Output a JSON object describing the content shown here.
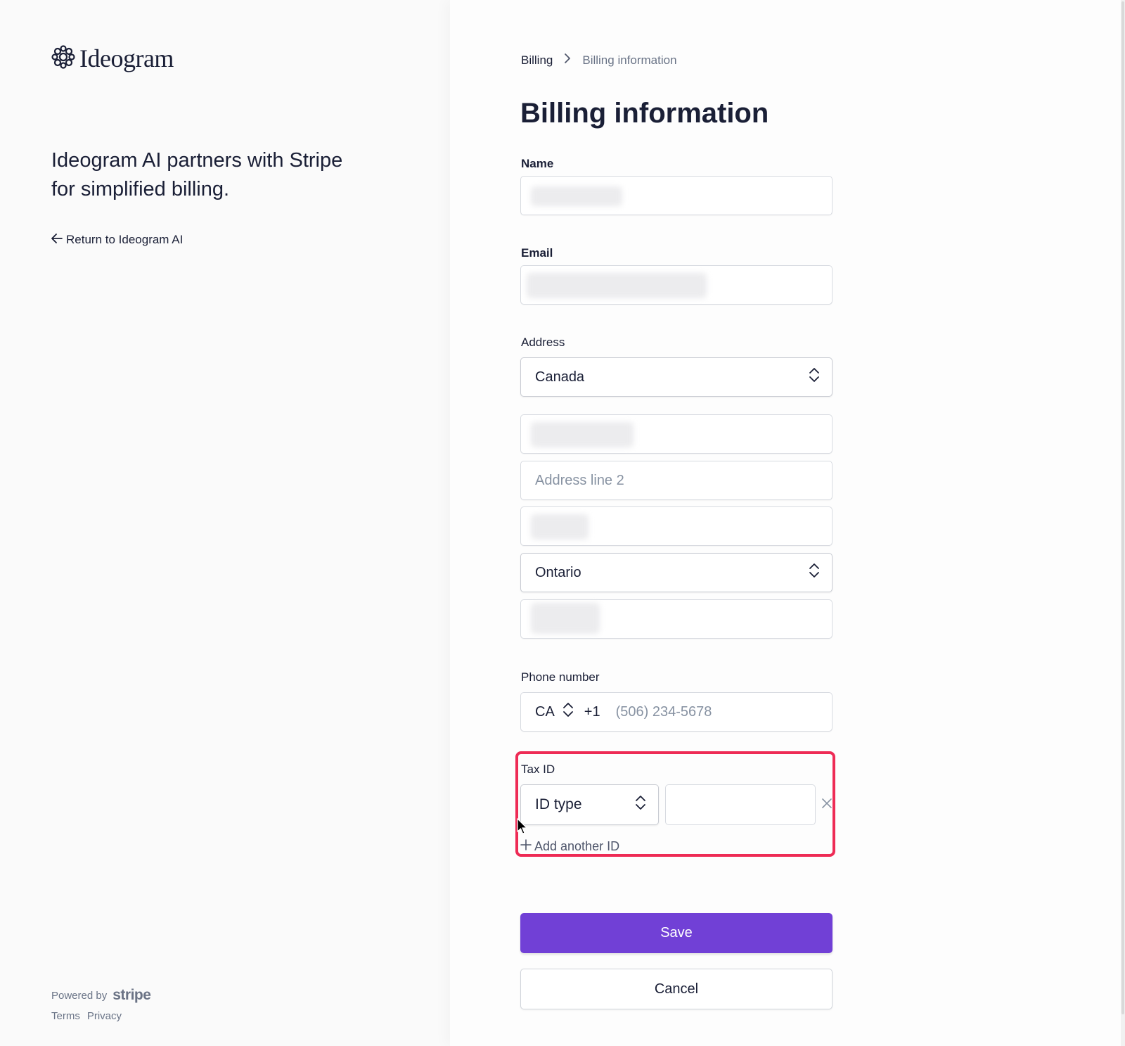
{
  "brand": {
    "logo_text": "Ideogram",
    "tagline": "Ideogram AI partners with Stripe for simplified billing.",
    "return_link": "Return to Ideogram AI",
    "powered_by": "Powered by",
    "stripe_word": "stripe",
    "footer_links": [
      "Terms",
      "Privacy"
    ]
  },
  "breadcrumb": {
    "parent": "Billing",
    "current": "Billing information"
  },
  "page_title": "Billing information",
  "form": {
    "name_label": "Name",
    "email_label": "Email",
    "address_label": "Address",
    "country_value": "Canada",
    "address_line2_placeholder": "Address line 2",
    "province_value": "Ontario",
    "phone_label": "Phone number",
    "phone_country": "CA",
    "phone_prefix": "+1",
    "phone_placeholder": "(506) 234-5678",
    "tax_id_label": "Tax ID",
    "id_type_placeholder": "ID type",
    "add_another_id": "Add another ID",
    "save_label": "Save",
    "cancel_label": "Cancel"
  },
  "icons": {
    "logo_mark": "brain-icon",
    "return": "arrow-left-icon",
    "breadcrumb_separator": "chevron-right-icon",
    "select_caret": "chevron-updown-icon",
    "remove": "close-icon",
    "add": "plus-icon"
  },
  "colors": {
    "accent": "#7140d6",
    "highlight": "#ee2b55",
    "text": "#1a1f36",
    "muted": "#697386"
  }
}
